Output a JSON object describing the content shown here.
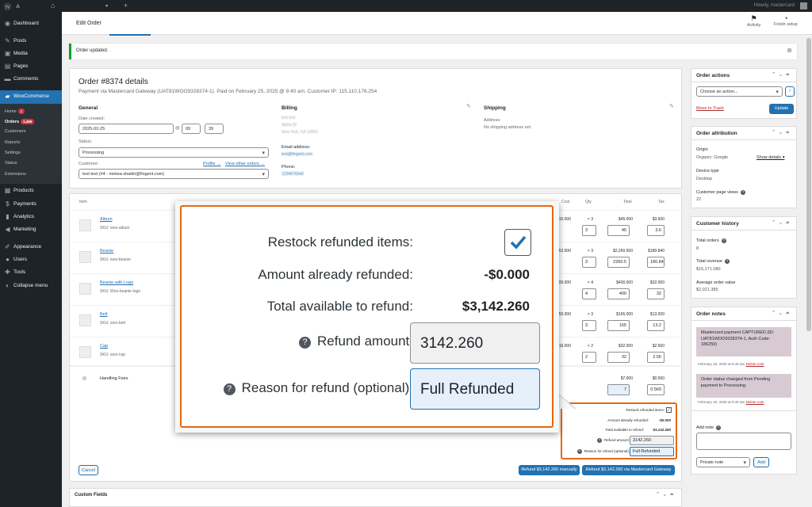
{
  "admin_bar": {
    "howdy": "Howdy, mastercard"
  },
  "menu": {
    "items": [
      {
        "label": "Dashboard",
        "icon": "dashboard-icon"
      },
      {
        "label": "Posts",
        "icon": "pin-icon"
      },
      {
        "label": "Media",
        "icon": "media-icon"
      },
      {
        "label": "Pages",
        "icon": "pages-icon"
      },
      {
        "label": "Comments",
        "icon": "comments-icon"
      },
      {
        "label": "WooCommerce",
        "icon": "woo-icon"
      },
      {
        "label": "Products",
        "icon": "products-icon"
      },
      {
        "label": "Payments",
        "icon": "payments-icon"
      },
      {
        "label": "Analytics",
        "icon": "analytics-icon"
      },
      {
        "label": "Marketing",
        "icon": "marketing-icon"
      },
      {
        "label": "Appearance",
        "icon": "appearance-icon"
      },
      {
        "label": "Users",
        "icon": "users-icon"
      },
      {
        "label": "Tools",
        "icon": "tools-icon"
      },
      {
        "label": "Collapse menu",
        "icon": "collapse-icon"
      }
    ],
    "sub": {
      "home": "Home",
      "home_badge": "1",
      "orders": "Orders",
      "orders_badge": "1,496",
      "customers": "Customers",
      "reports": "Reports",
      "settings": "Settings",
      "status": "Status",
      "extensions": "Extensions"
    }
  },
  "header": {
    "title": "Edit Order",
    "activity": "Activity",
    "finish": "Finish setup"
  },
  "notice": {
    "text": "Order updated."
  },
  "order": {
    "title": "Order #8374 details",
    "subtitle": "Payment via Mastercard Gateway (UAT81WOO9328374-1). Paid on February 25, 2025 @ 9:40 am. Customer IP: 115.110.176.254",
    "general": {
      "heading": "General",
      "date_label": "Date created:",
      "date": "2025-02-25",
      "at": "@",
      "hour": "09",
      "minute": "39",
      "colon": ":",
      "status_label": "Status:",
      "status": "Processing",
      "customer_label": "Customer:",
      "profile": "Profile →",
      "other_orders": "View other orders →",
      "customer": "test test (#4 - mistea.shaikh@fingent.com)"
    },
    "billing": {
      "heading": "Billing",
      "address": [
        "test test",
        "Alpha St",
        "New York, CA 10001"
      ],
      "email_label": "Email address:",
      "email": "test@fingent.com",
      "phone_label": "Phone:",
      "phone": "1234576543"
    },
    "shipping": {
      "heading": "Shipping",
      "address_label": "Address:",
      "address": "No shipping address set."
    }
  },
  "items": {
    "headers": {
      "item": "Item",
      "cost": "Cost",
      "qty": "Qty",
      "total": "Total",
      "tax": "Tax"
    },
    "rows": [
      {
        "name": "Album",
        "sku": "SKU: woo-album",
        "cost": "15.000",
        "qty": "× 3",
        "total": "$45.000",
        "tax": "$3.600",
        "rq": "3",
        "rt": "45",
        "rtax": "3.6"
      },
      {
        "name": "Beanie",
        "sku": "SKU: woo-beanie",
        "cost": "53.500",
        "qty": "× 3",
        "total": "$2,260.500",
        "tax": "$180.840",
        "rq": "3",
        "rt": "2260.5",
        "rtax": "180.84"
      },
      {
        "name": "Beanie with Logo",
        "sku": "SKU: Woo-beanie-logo",
        "cost": "00.000",
        "qty": "× 4",
        "total": "$400.000",
        "tax": "$32.000",
        "rq": "4",
        "rt": "400",
        "rtax": "32"
      },
      {
        "name": "Belt",
        "sku": "SKU: woo-belt",
        "cost": "55.000",
        "qty": "× 3",
        "total": "$165.000",
        "tax": "$13.200",
        "rq": "3",
        "rt": "165",
        "rtax": "13.2"
      },
      {
        "name": "Cap",
        "sku": "SKU: woo-cap",
        "cost": "16.000",
        "qty": "× 2",
        "total": "$32.000",
        "tax": "$2.560",
        "rq": "2",
        "rt": "32",
        "rtax": "2.56"
      }
    ],
    "fee": {
      "name": "Handling Fees",
      "total": "$7.000",
      "tax": "$0.560",
      "rt": "7",
      "rtax": "0.560"
    }
  },
  "refund": {
    "restock_label": "Restock refunded items:",
    "already_label": "Amount already refunded:",
    "already_value": "-$0.000",
    "available_label": "Total available to refund:",
    "available_value": "$3,142.260",
    "amount_label": "Refund amount:",
    "amount_value": "3142.260",
    "reason_label": "Reason for refund (optional):",
    "reason_value": "Full Refunded",
    "help_glyph": "?",
    "cancel": "Cancel",
    "refund_manual": "Refund $3,142.260 manually",
    "refund_gateway": "Refund $3,142.260 via Mastercard Gateway"
  },
  "actions": {
    "title": "Order actions",
    "select": "Choose an action...",
    "trash": "Move to Trash",
    "update": "Update"
  },
  "attribution": {
    "title": "Order attribution",
    "origin_label": "Origin",
    "origin": "Organic: Google",
    "show_details": "Show details ▾",
    "device_label": "Device type",
    "device": "Desktop",
    "views_label": "Customer page views",
    "views": "22"
  },
  "history": {
    "title": "Customer history",
    "orders_label": "Total orders",
    "orders": "8",
    "revenue_label": "Total revenue",
    "revenue": "$16,171.080",
    "avg_label": "Average order value",
    "avg": "$2,021.385"
  },
  "notes": {
    "title": "Order notes",
    "list": [
      {
        "text": "Mastercard payment CAPTURED (ID: UAT81WOO9328374-1, Auth Code: 186250)",
        "date": "February 25, 2025 at 9:40 am",
        "delete": "Delete note"
      },
      {
        "text": "Order status changed from Pending payment to Processing.",
        "date": "February 25, 2025 at 9:40 am",
        "delete": "Delete note"
      }
    ],
    "add_label": "Add note",
    "type": "Private note",
    "add_btn": "Add"
  },
  "custom_fields": {
    "title": "Custom Fields"
  }
}
